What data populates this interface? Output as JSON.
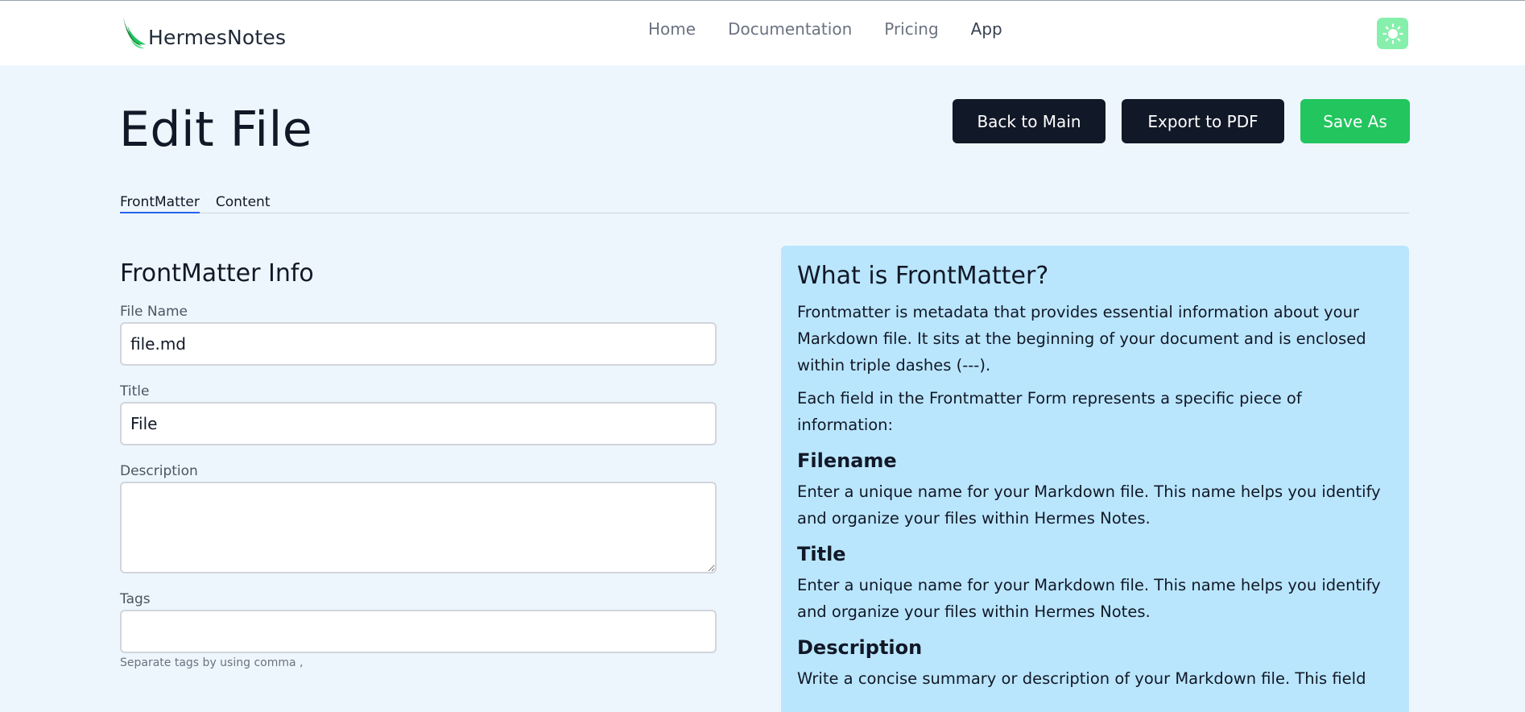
{
  "brand": {
    "name": "HermesNotes"
  },
  "nav": {
    "links": [
      {
        "label": "Home"
      },
      {
        "label": "Documentation"
      },
      {
        "label": "Pricing"
      },
      {
        "label": "App"
      }
    ]
  },
  "theme_toggle": {
    "icon": "sun-icon",
    "color": "#86efac"
  },
  "page": {
    "title": "Edit File",
    "actions": {
      "back": "Back to Main",
      "export": "Export to PDF",
      "save": "Save As"
    }
  },
  "tabs": [
    {
      "label": "FrontMatter",
      "active": true
    },
    {
      "label": "Content",
      "active": false
    }
  ],
  "form": {
    "heading": "FrontMatter Info",
    "file_name": {
      "label": "File Name",
      "value": "file.md"
    },
    "title": {
      "label": "Title",
      "value": "File"
    },
    "description": {
      "label": "Description",
      "value": ""
    },
    "tags": {
      "label": "Tags",
      "value": "",
      "hint": "Separate tags by using comma ,"
    }
  },
  "info": {
    "title": "What is FrontMatter?",
    "intro": "Frontmatter is metadata that provides essential information about your Markdown file. It sits at the beginning of your document and is enclosed within triple dashes (---).",
    "intro2": "Each field in the Frontmatter Form represents a specific piece of information:",
    "sections": [
      {
        "heading": "Filename",
        "text": "Enter a unique name for your Markdown file. This name helps you identify and organize your files within Hermes Notes."
      },
      {
        "heading": "Title",
        "text": "Enter a unique name for your Markdown file. This name helps you identify and organize your files within Hermes Notes."
      },
      {
        "heading": "Description",
        "text": "Write a concise summary or description of your Markdown file. This field"
      }
    ]
  },
  "colors": {
    "accent_green": "#22c55e",
    "dark_button": "#111827",
    "panel_blue": "#bae6fd",
    "tab_underline": "#2563eb",
    "page_background": "#eef6fd"
  }
}
